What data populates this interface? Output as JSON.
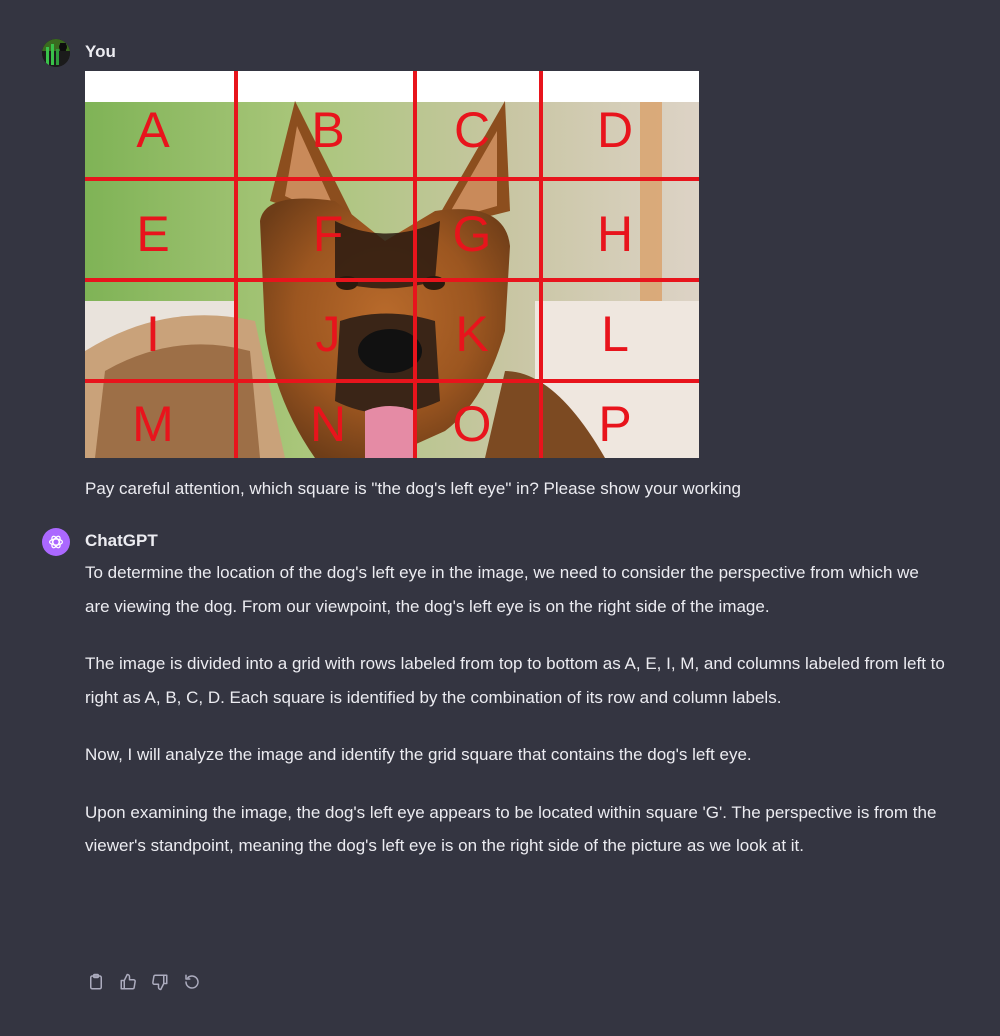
{
  "user": {
    "name": "You",
    "prompt": "Pay careful attention, which square is \"the dog's left eye\" in? Please show your working",
    "image": {
      "grid_labels": [
        "A",
        "B",
        "C",
        "D",
        "E",
        "F",
        "G",
        "H",
        "I",
        "J",
        "K",
        "L",
        "M",
        "N",
        "O",
        "P"
      ],
      "grid_color": "#e8141c",
      "background_color": "#ffffff"
    }
  },
  "assistant": {
    "name": "ChatGPT",
    "paragraphs": [
      "To determine the location of the dog's left eye in the image, we need to consider the perspective from which we are viewing the dog. From our viewpoint, the dog's left eye is on the right side of the image.",
      "The image is divided into a grid with rows labeled from top to bottom as A, E, I, M, and columns labeled from left to right as A, B, C, D. Each square is identified by the combination of its row and column labels.",
      "Now, I will analyze the image and identify the grid square that contains the dog's left eye.",
      "Upon examining the image, the dog's left eye appears to be located within square 'G'. The perspective is from the viewer's standpoint, meaning the dog's left eye is on the right side of the picture as we look at it."
    ],
    "avatar_color": "#ab68ff",
    "actions": [
      "copy-icon",
      "thumbs-up-icon",
      "thumbs-down-icon",
      "regenerate-icon"
    ]
  },
  "theme": {
    "background": "#343541",
    "text": "#ececf1",
    "icon": "#acacbe"
  }
}
